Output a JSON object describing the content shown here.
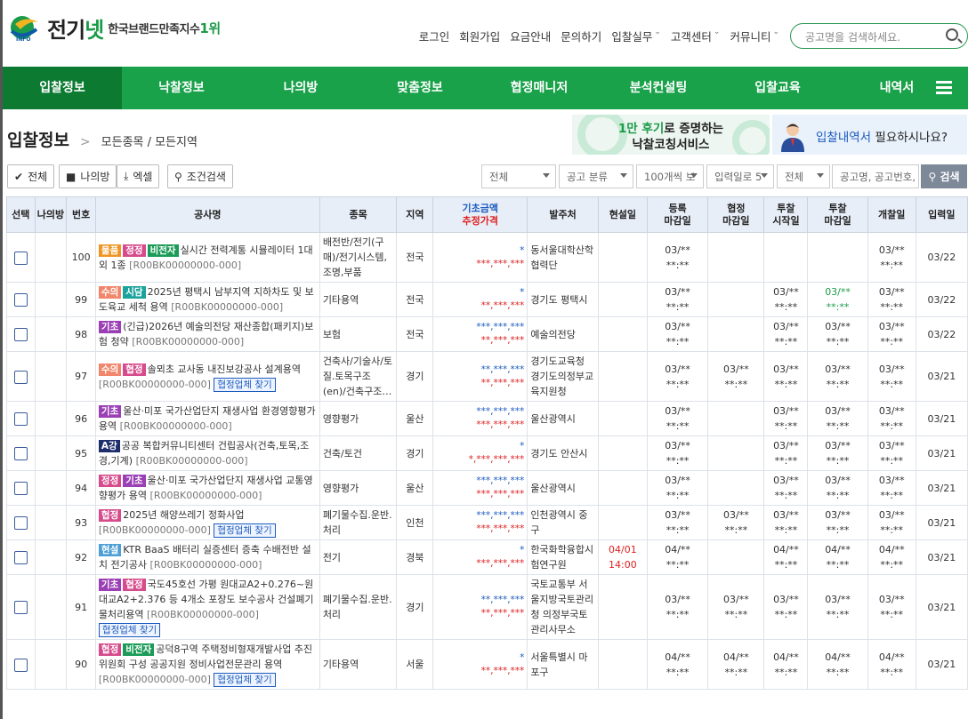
{
  "brand": {
    "name_a": "전기",
    "name_b": "넷",
    "slogan": "한국브랜드만족지수",
    "slogan_rank": "1위",
    "mark_text": "INFO"
  },
  "topnav": {
    "links": [
      {
        "label": "로그인"
      },
      {
        "label": "회원가입"
      },
      {
        "label": "요금안내"
      },
      {
        "label": "문의하기"
      },
      {
        "label": "입찰실무",
        "arrow": "⌄"
      },
      {
        "label": "고객센터",
        "arrow": "⌄"
      },
      {
        "label": "커뮤니티",
        "arrow": "⌄"
      }
    ],
    "search_placeholder": "공고명을 검색하세요."
  },
  "mainnav": [
    "입찰정보",
    "낙찰정보",
    "나의방",
    "맞춤정보",
    "협정매니저",
    "분석컨설팅",
    "입찰교육",
    "내역서"
  ],
  "breadcrumb": {
    "title": "입찰정보",
    "sep": ">",
    "sub": "모든종목 / 모든지역"
  },
  "banners": {
    "b1_line1_hl": "1만 후기",
    "b1_line1": "로 증명하는",
    "b1_line2": "낙찰코칭서비스",
    "b2_hl": "입찰내역서",
    "b2_text": " 필요하시나요?"
  },
  "toolbar": {
    "all": "전체",
    "myroom": "나의방",
    "excel": "엑셀",
    "cond": "조건검색",
    "filters": [
      "전체",
      "공고 분류",
      "100개씩 보",
      "입력일로 5",
      "전체"
    ],
    "search_placeholder": "공고명, 공고번호, ",
    "search_btn": "검색"
  },
  "headers": [
    "선택",
    "나의방",
    "번호",
    "공사명",
    "종목",
    "지역",
    "기초금액",
    "추정가격",
    "발주처",
    "현설일",
    "등록",
    "마감일",
    "협정",
    "마감일",
    "투찰",
    "시작일",
    "투찰",
    "마감일",
    "개찰일",
    "입력일"
  ],
  "rows": [
    {
      "no": "100",
      "tags": [
        {
          "t": "물품",
          "c": "orange"
        },
        {
          "t": "정정",
          "c": "pink"
        },
        {
          "t": "비전자",
          "c": "green"
        }
      ],
      "title": "실시간 전력계통 시뮬레이터 1대 외 1종",
      "code": "[R00BK00000000-000]",
      "hz": "",
      "kind": "배전반/전기(구매)/전기시스템,조명,부품",
      "region": "전국",
      "base": "*",
      "est": "***,***,***",
      "est_color": "rd",
      "client": "동서울대학산학협력단",
      "site": "",
      "d1a": "03/**",
      "d1b": "**:**",
      "d2a": "",
      "d2b": "",
      "d3a": "",
      "d3b": "",
      "d4a": "",
      "d4b": "",
      "d5a": "03/**",
      "d5b": "**:**",
      "input": "03/22",
      "d4green": false
    },
    {
      "no": "99",
      "tags": [
        {
          "t": "수의",
          "c": "salmon"
        },
        {
          "t": "시담",
          "c": "teal"
        }
      ],
      "title": "2025년 평택시 남부지역 지하차도 및 보도육교 세척 용역",
      "code": "[R00BK00000000-000]",
      "hz": "",
      "kind": "기타용역",
      "region": "전국",
      "base": "*",
      "est": "**,***,***",
      "est_color": "rd",
      "client": "경기도 평택시",
      "site": "",
      "d1a": "03/**",
      "d1b": "**:**",
      "d2a": "",
      "d2b": "",
      "d3a": "03/**",
      "d3b": "**:**",
      "d4a": "03/**",
      "d4b": "**:**",
      "d5a": "03/**",
      "d5b": "**:**",
      "input": "03/22",
      "d4green": true
    },
    {
      "no": "98",
      "tags": [
        {
          "t": "기초",
          "c": "purple"
        }
      ],
      "title": "(긴급)2026년 예술의전당 재산종합(패키지)보험 청약",
      "code": "[R00BK00000000-000]",
      "hz": "",
      "kind": "보험",
      "region": "전국",
      "base": "***,***,***",
      "est": "**,***,***",
      "est_color": "rd",
      "client": "예술의전당",
      "site": "",
      "d1a": "03/**",
      "d1b": "**:**",
      "d2a": "",
      "d2b": "",
      "d3a": "03/**",
      "d3b": "**:**",
      "d4a": "03/**",
      "d4b": "**:**",
      "d5a": "03/**",
      "d5b": "**:**",
      "input": "03/22",
      "d4green": false
    },
    {
      "no": "97",
      "tags": [
        {
          "t": "수의",
          "c": "salmon"
        },
        {
          "t": "협정",
          "c": "pink"
        }
      ],
      "title": "솔뫼초 교사동 내진보강공사 설계용역",
      "code": "[R00BK00000000-000]",
      "hz": "협정업체 찾기",
      "kind": "건축사/기술사/토질.토목구조(en)/건축구조…",
      "region": "경기",
      "base": "**,***,***",
      "est": "**,***,***",
      "est_color": "rd",
      "client": "경기도교육청 경기도의정부교육지원청",
      "site": "",
      "d1a": "03/**",
      "d1b": "**:**",
      "d2a": "03/**",
      "d2b": "**:**",
      "d3a": "03/**",
      "d3b": "**:**",
      "d4a": "03/**",
      "d4b": "**:**",
      "d5a": "03/**",
      "d5b": "**:**",
      "input": "03/21",
      "d4green": false
    },
    {
      "no": "96",
      "tags": [
        {
          "t": "기초",
          "c": "purple"
        }
      ],
      "title": "울산·미포 국가산업단지 재생사업 환경영향평가 용역",
      "code": "[R00BK00000000-000]",
      "hz": "",
      "kind": "영향평가",
      "region": "울산",
      "base": "***,***,***",
      "est": "***,***,***",
      "est_color": "rd",
      "client": "울산광역시",
      "site": "",
      "d1a": "03/**",
      "d1b": "**:**",
      "d2a": "",
      "d2b": "",
      "d3a": "03/**",
      "d3b": "**:**",
      "d4a": "03/**",
      "d4b": "**:**",
      "d5a": "03/**",
      "d5b": "**:**",
      "input": "03/21",
      "d4green": false
    },
    {
      "no": "95",
      "tags": [
        {
          "t": "A강",
          "c": "navy"
        }
      ],
      "title": "공공 복합커뮤니티센터 건립공사(건축,토목,조경,기계)",
      "code": "[R00BK00000000-000]",
      "hz": "",
      "kind": "건축/토건",
      "region": "경기",
      "base": "*",
      "est": "*,***,***,***",
      "est_color": "rd",
      "client": "경기도 안산시",
      "site": "",
      "d1a": "03/**",
      "d1b": "**:**",
      "d2a": "",
      "d2b": "",
      "d3a": "03/**",
      "d3b": "**:**",
      "d4a": "03/**",
      "d4b": "**:**",
      "d5a": "03/**",
      "d5b": "**:**",
      "input": "03/21",
      "d4green": false
    },
    {
      "no": "94",
      "tags": [
        {
          "t": "정정",
          "c": "pink"
        },
        {
          "t": "기초",
          "c": "purple"
        }
      ],
      "title": "울산·미포 국가산업단지 재생사업 교통영향평가 용역",
      "code": "[R00BK00000000-000]",
      "hz": "",
      "kind": "영향평가",
      "region": "울산",
      "base": "***,***,***",
      "est": "***,***,***",
      "est_color": "rd",
      "client": "울산광역시",
      "site": "",
      "d1a": "03/**",
      "d1b": "**:**",
      "d2a": "",
      "d2b": "",
      "d3a": "03/**",
      "d3b": "**:**",
      "d4a": "03/**",
      "d4b": "**:**",
      "d5a": "03/**",
      "d5b": "**:**",
      "input": "03/21",
      "d4green": false
    },
    {
      "no": "93",
      "tags": [
        {
          "t": "협정",
          "c": "pink"
        }
      ],
      "title": "2025년 해양쓰레기 정화사업",
      "code": "[R00BK00000000-000]",
      "hz": "협정업체 찾기",
      "kind": "폐기물수집.운반.처리",
      "region": "인천",
      "base": "***,***,***",
      "est": "***,***,***",
      "est_color": "rd",
      "client": "인천광역시 중구",
      "site": "",
      "d1a": "03/**",
      "d1b": "**:**",
      "d2a": "03/**",
      "d2b": "**:**",
      "d3a": "03/**",
      "d3b": "**:**",
      "d4a": "03/**",
      "d4b": "**:**",
      "d5a": "03/**",
      "d5b": "**:**",
      "input": "03/21",
      "d4green": false
    },
    {
      "no": "92",
      "tags": [
        {
          "t": "현설",
          "c": "lblue"
        }
      ],
      "title": "KTR BaaS 배터리 실증센터 증축 수배전반 설치 전기공사",
      "code": "[R00BK00000000-000]",
      "hz": "",
      "kind": "전기",
      "region": "경북",
      "base": "*",
      "est": "***,***,***",
      "est_color": "rd",
      "client": "한국화학융합시험연구원",
      "site": "04/01 14:00",
      "d1a": "04/**",
      "d1b": "**:**",
      "d2a": "",
      "d2b": "",
      "d3a": "04/**",
      "d3b": "**:**",
      "d4a": "04/**",
      "d4b": "**:**",
      "d5a": "04/**",
      "d5b": "**:**",
      "input": "03/21",
      "d4green": false
    },
    {
      "no": "91",
      "tags": [
        {
          "t": "기초",
          "c": "purple"
        },
        {
          "t": "협정",
          "c": "pink"
        }
      ],
      "title": "국도45호선 가평 원대교A2+0.276~원대교A2+2.376 등 4개소 포장도 보수공사 건설폐기물처리용역",
      "code": "[R00BK00000000-000]",
      "hz": "협정업체 찾기",
      "kind": "폐기물수집.운반.처리",
      "region": "경기",
      "base": "**,***,***",
      "est": "**,***,***",
      "est_color": "rd",
      "client": "국토교통부 서울지방국토관리청 의정부국토관리사무소",
      "site": "",
      "d1a": "03/**",
      "d1b": "**:**",
      "d2a": "03/**",
      "d2b": "**:**",
      "d3a": "03/**",
      "d3b": "**:**",
      "d4a": "03/**",
      "d4b": "**:**",
      "d5a": "03/**",
      "d5b": "**:**",
      "input": "03/21",
      "d4green": false
    },
    {
      "no": "90",
      "tags": [
        {
          "t": "협정",
          "c": "pink"
        },
        {
          "t": "비전자",
          "c": "green"
        }
      ],
      "title": "공덕8구역 주택정비형재개발사업 추진위원회 구성 공공지원 정비사업전문관리 용역",
      "code": "[R00BK00000000-000]",
      "hz": "협정업체 찾기",
      "kind": "기타용역",
      "region": "서울",
      "base": "*",
      "est": "**,***,***",
      "est_color": "rd",
      "client": "서울특별시 마포구",
      "site": "",
      "d1a": "04/**",
      "d1b": "**:**",
      "d2a": "04/**",
      "d2b": "**:**",
      "d3a": "04/**",
      "d3b": "**:**",
      "d4a": "04/**",
      "d4b": "**:**",
      "d5a": "04/**",
      "d5b": "**:**",
      "input": "03/21",
      "d4green": false
    }
  ],
  "colors": {
    "brand_green": "#19a24a",
    "nav_active": "#0d7a32",
    "accent_blue": "#1b5bbf",
    "accent_red": "#d22"
  }
}
